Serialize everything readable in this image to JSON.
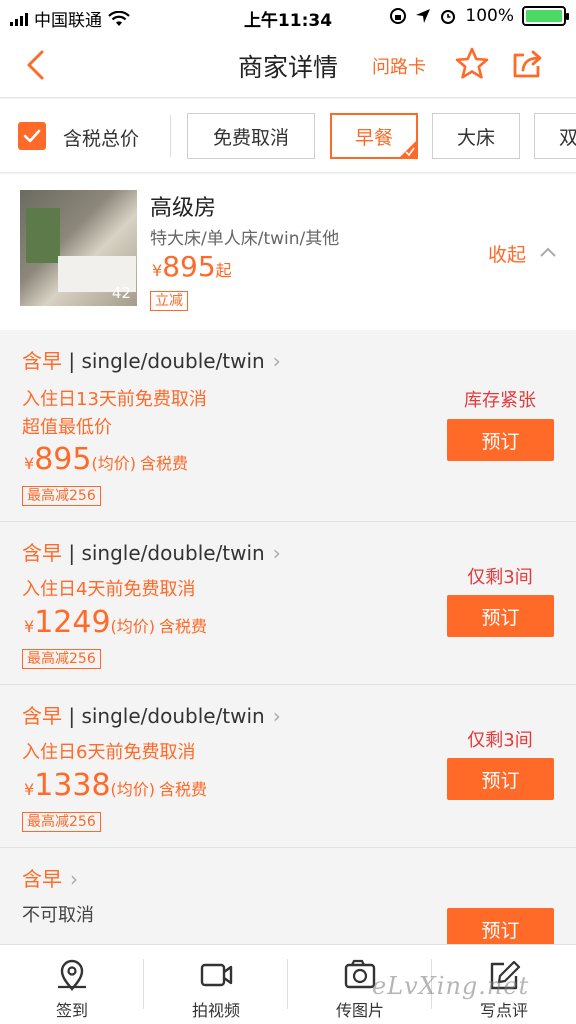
{
  "status_bar": {
    "carrier": "中国联通",
    "time": "上午11:34",
    "battery_percent": "100%"
  },
  "header": {
    "title": "商家详情",
    "ask_way_label": "问路卡"
  },
  "filters": {
    "tax_inclusive_label": "含税总价",
    "tax_inclusive_checked": true,
    "chips": [
      {
        "label": "免费取消",
        "active": false
      },
      {
        "label": "早餐",
        "active": true
      },
      {
        "label": "大床",
        "active": false
      },
      {
        "label": "双",
        "active": false
      }
    ]
  },
  "room": {
    "name": "高级房",
    "beds": "特大床/单人床/twin/其他",
    "currency": "¥",
    "price": "895",
    "price_suffix": "起",
    "photo_count": "42",
    "discount_tag": "立减",
    "collapse_label": "收起"
  },
  "offers": [
    {
      "meal": "含早",
      "separator": " | ",
      "beds": "single/double/twin",
      "cancel": "入住日13天前免费取消",
      "promo": "超值最低价",
      "currency": "¥",
      "price": "895",
      "avg": "(均价)",
      "tax": "含税费",
      "max_discount": "最高减256",
      "stock": "库存紧张",
      "book_label": "预订"
    },
    {
      "meal": "含早",
      "separator": " | ",
      "beds": "single/double/twin",
      "cancel": "入住日4天前免费取消",
      "currency": "¥",
      "price": "1249",
      "avg": "(均价)",
      "tax": "含税费",
      "max_discount": "最高减256",
      "stock": "仅剩3间",
      "book_label": "预订"
    },
    {
      "meal": "含早",
      "separator": " | ",
      "beds": "single/double/twin",
      "cancel": "入住日6天前免费取消",
      "currency": "¥",
      "price": "1338",
      "avg": "(均价)",
      "tax": "含税费",
      "max_discount": "最高减256",
      "stock": "仅剩3间",
      "book_label": "预订"
    },
    {
      "meal": "含早",
      "cancel": "不可取消",
      "book_label": "预订"
    }
  ],
  "tabbar": [
    {
      "label": "签到",
      "icon": "location-pin-icon"
    },
    {
      "label": "拍视频",
      "icon": "video-camera-icon"
    },
    {
      "label": "传图片",
      "icon": "image-upload-icon"
    },
    {
      "label": "写点评",
      "icon": "edit-review-icon"
    }
  ],
  "watermark": "eLvXing.net",
  "colors": {
    "accent": "#ff6a28",
    "stock_warning": "#e4393c",
    "background": "#f4f4f4"
  }
}
